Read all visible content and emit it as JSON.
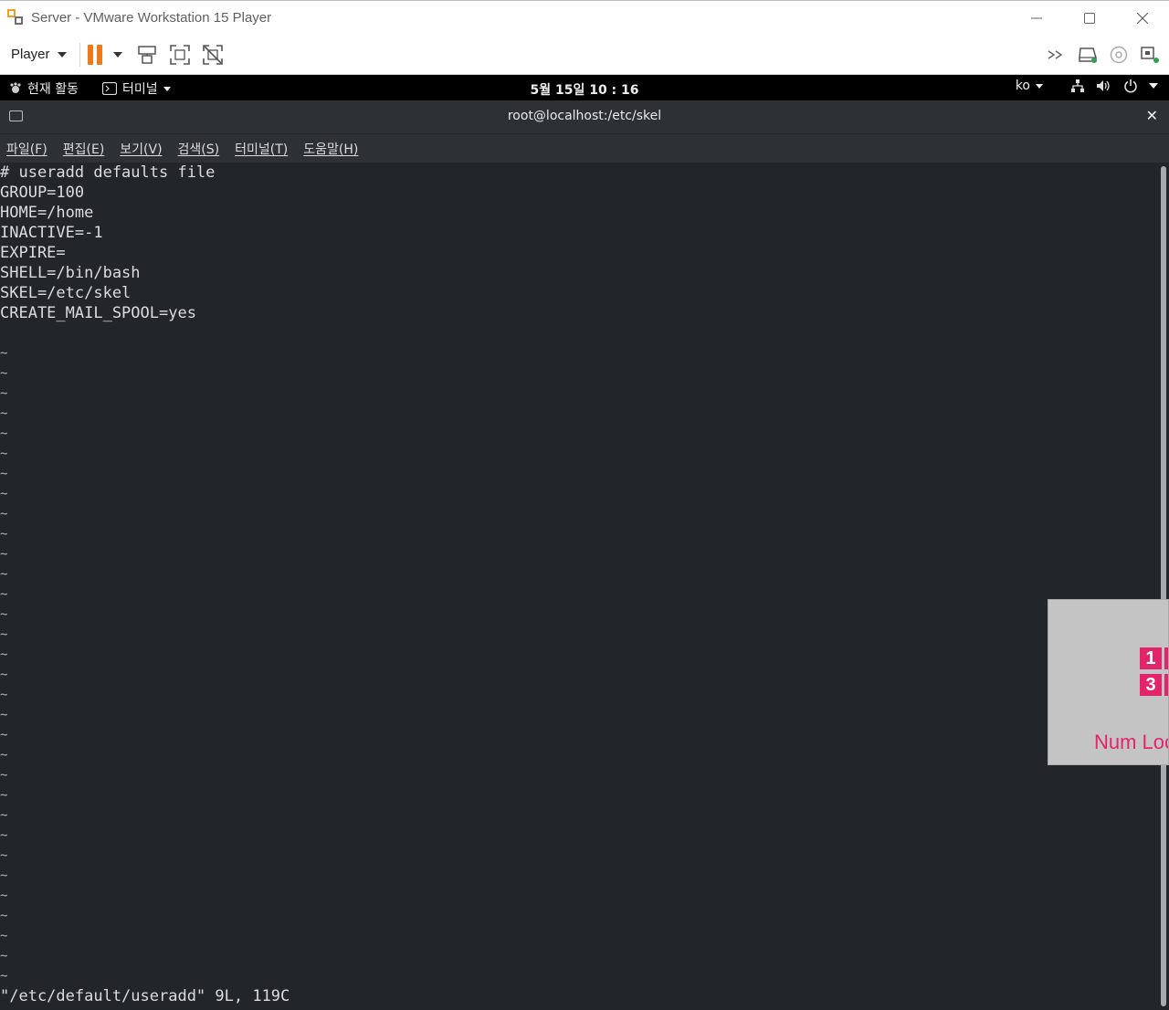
{
  "window": {
    "title": "Server - VMware Workstation 15 Player"
  },
  "vm_toolbar": {
    "player_menu_label": "Player"
  },
  "gnome_bar": {
    "activities_label": "현재 활동",
    "app_menu_label": "터미널",
    "clock": "5월 15일  10 : 16",
    "input_method": "ko"
  },
  "terminal": {
    "title": "root@localhost:/etc/skel",
    "menu": [
      "파일(F)",
      "편집(E)",
      "보기(V)",
      "검색(S)",
      "터미널(T)",
      "도움말(H)"
    ],
    "lines": [
      "# useradd defaults file",
      "GROUP=100",
      "HOME=/home",
      "INACTIVE=-1",
      "EXPIRE=",
      "SHELL=/bin/bash",
      "SKEL=/etc/skel",
      "CREATE_MAIL_SPOOL=yes",
      ""
    ],
    "tilde_char": "~",
    "tilde_count": 32,
    "status": "\"/etc/default/useradd\" 9L, 119C"
  },
  "osd": {
    "key1": "1",
    "key3": "3",
    "label": "Num Lock"
  },
  "colors": {
    "terminal_bg": "#222629",
    "terminal_fg": "#dcdcdc",
    "pause_accent": "#ee7a1e",
    "osd_accent": "#e2246a"
  }
}
